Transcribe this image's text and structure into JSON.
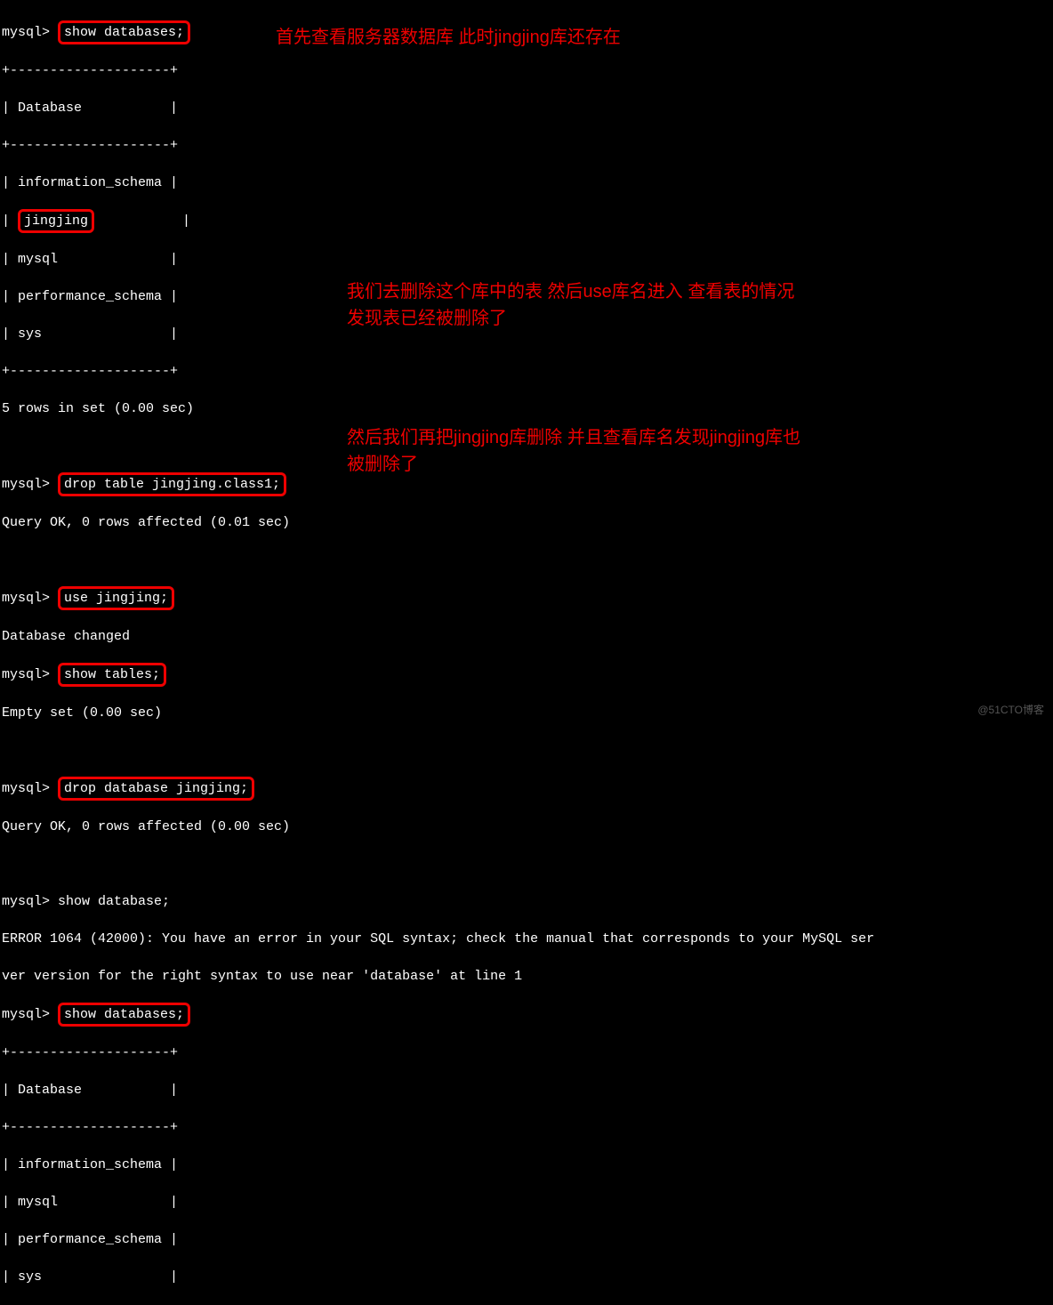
{
  "prompt": "mysql> ",
  "cmds": {
    "show_db1": "show databases;",
    "drop_table": "drop table jingjing.class1;",
    "use_db": "use jingjing;",
    "show_tables": "show tables;",
    "drop_db": "drop database jingjing;",
    "show_db_err": "show database;",
    "show_db2": "show databases;"
  },
  "outputs": {
    "tbl_sep": "+--------------------+",
    "tbl_head": "| Database           |",
    "row_info": "| information_schema |",
    "row_jing_pre": "| ",
    "row_jing": "jingjing",
    "row_jing_post": "           |",
    "row_mysql": "| mysql              |",
    "row_perf": "| performance_schema |",
    "row_sys": "| sys                |",
    "rows5": "5 rows in set (0.00 sec)",
    "ok001": "Query OK, 0 rows affected (0.01 sec)",
    "ok000": "Query OK, 0 rows affected (0.00 sec)",
    "db_changed": "Database changed",
    "empty_set": "Empty set (0.00 sec)",
    "err1": "ERROR 1064 (42000): You have an error in your SQL syntax; check the manual that corresponds to your MySQL ser",
    "err2": "ver version for the right syntax to use near 'database' at line 1"
  },
  "annotations": {
    "a1": "首先查看服务器数据库 此时jingjing库还存在",
    "a2a": "我们去删除这个库中的表  然后use库名进入 查看表的情况",
    "a2b": "发现表已经被删除了",
    "a3a": "然后我们再把jingjing库删除 并且查看库名发现jingjing库也",
    "a3b": "被删除了"
  },
  "watermark": "@51CTO博客"
}
